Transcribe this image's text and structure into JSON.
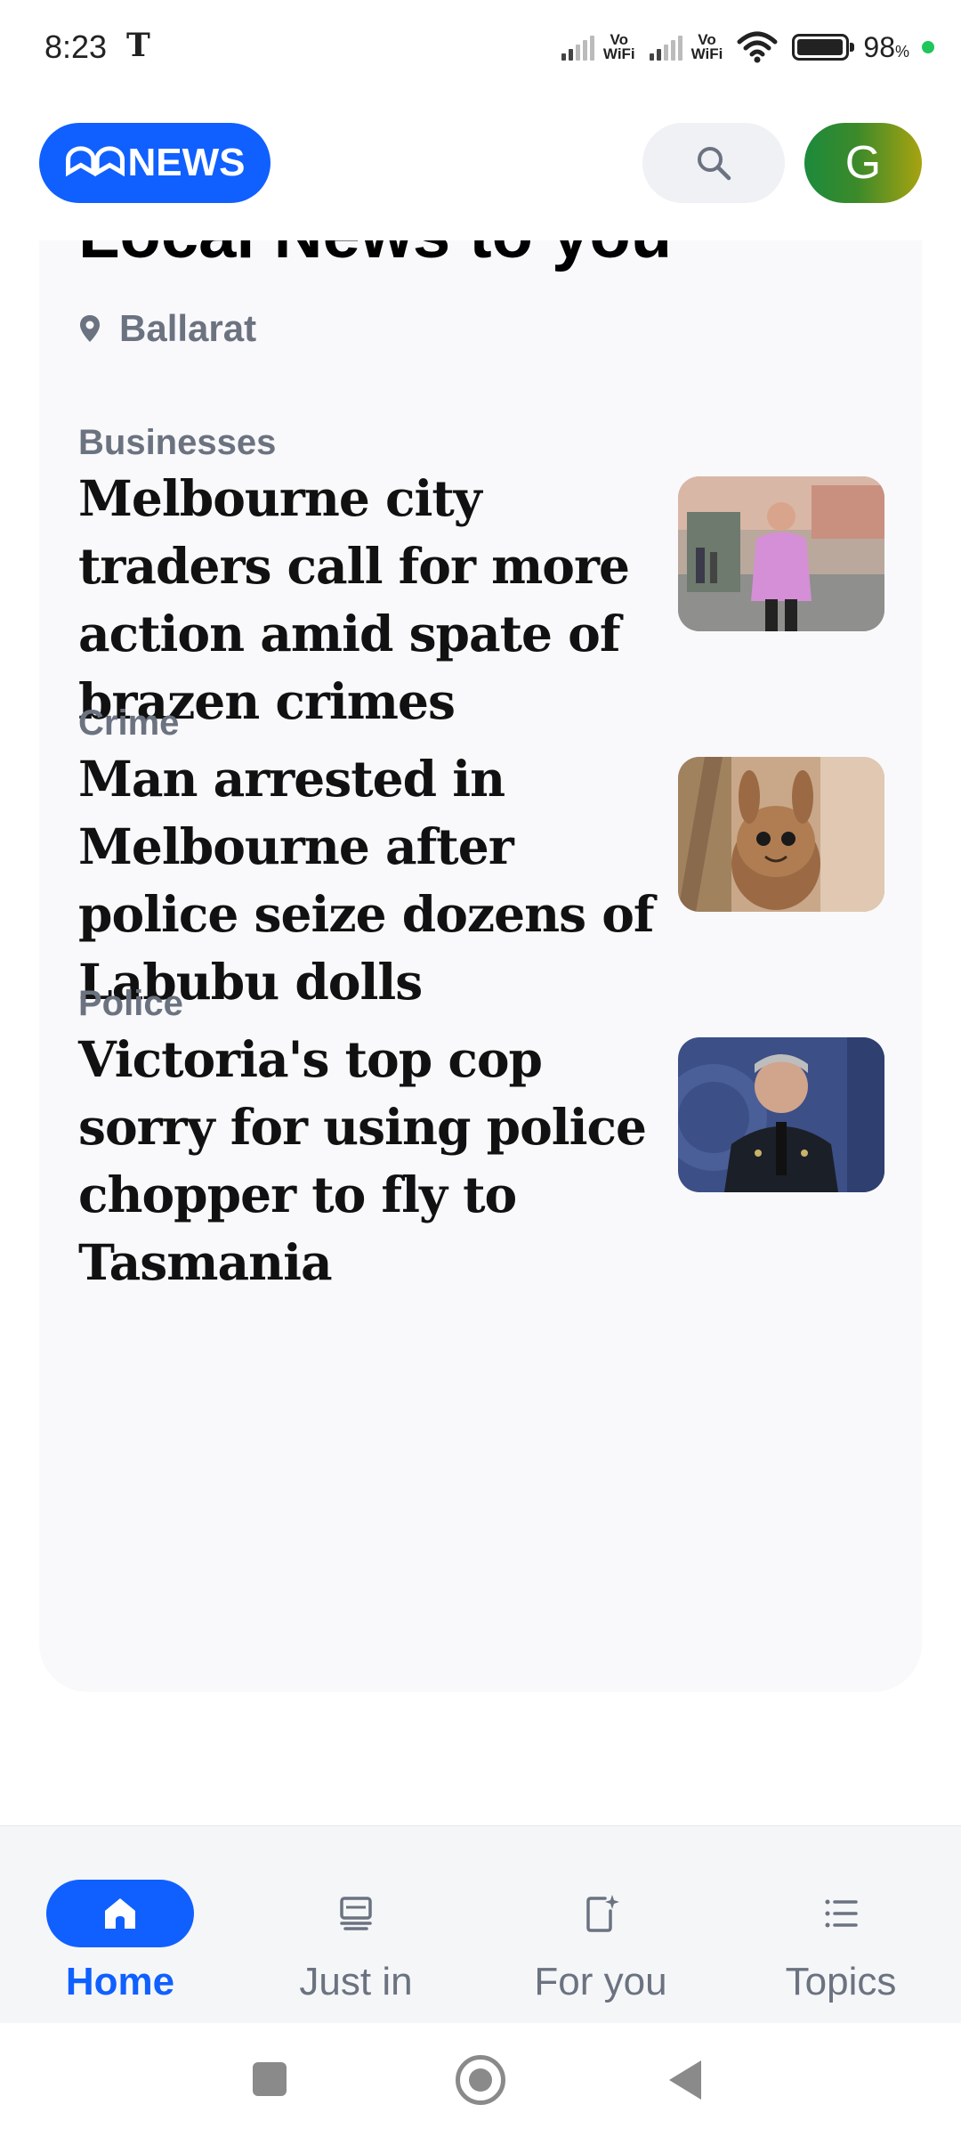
{
  "status_bar": {
    "time": "8:23",
    "carrier_icon": "T",
    "vowifi_1": "Vo\nWiFi",
    "vowifi_2": "Vo\nWiFi",
    "battery_percent": "98",
    "battery_unit": "%"
  },
  "header": {
    "logo_mark": "ᗣᗣ",
    "logo_text": "NEWS",
    "avatar_letter": "G",
    "colors": {
      "brand": "#1060ff"
    }
  },
  "section": {
    "title": "Local News to you",
    "location": "Ballarat"
  },
  "stories": [
    {
      "topic": "Businesses",
      "title": "Melbourne city traders call for more action amid spate of brazen crimes",
      "thumb": "man-in-pink-shirt-street-photo"
    },
    {
      "topic": "Crime",
      "title": "Man arrested in Melbourne after police seize dozens of Labubu dolls",
      "thumb": "labubu-doll-photo"
    },
    {
      "topic": "Police",
      "title": "Victoria's top cop sorry for using police chopper to fly to Tasmania",
      "thumb": "police-chief-portrait-photo"
    }
  ],
  "bottom_nav": {
    "items": [
      {
        "label": "Home",
        "icon": "home-icon",
        "active": true
      },
      {
        "label": "Just in",
        "icon": "just-in-icon",
        "active": false
      },
      {
        "label": "For you",
        "icon": "for-you-icon",
        "active": false
      },
      {
        "label": "Topics",
        "icon": "topics-icon",
        "active": false
      }
    ]
  }
}
